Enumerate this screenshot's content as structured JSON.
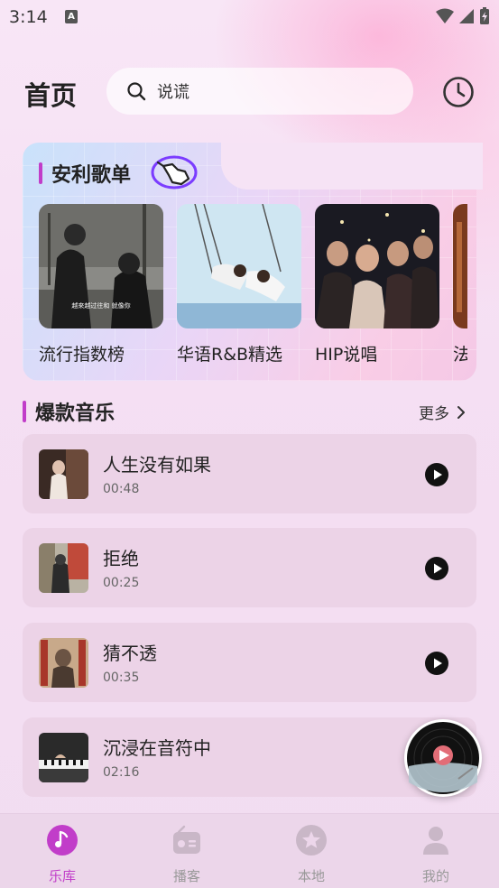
{
  "status_bar": {
    "time": "3:14"
  },
  "header": {
    "title": "首页",
    "search_placeholder": "说谎",
    "history_icon": "clock-icon"
  },
  "featured": {
    "title": "安利歌单",
    "playlists": [
      {
        "name": "流行指数榜",
        "cover_caption": "越來越过往和 就像你"
      },
      {
        "name": "华语R&B精选"
      },
      {
        "name": "HIP说唱"
      },
      {
        "name": "法"
      }
    ]
  },
  "hot": {
    "title": "爆款音乐",
    "more_label": "更多",
    "songs": [
      {
        "title": "人生没有如果",
        "duration": "00:48"
      },
      {
        "title": "拒绝",
        "duration": "00:25"
      },
      {
        "title": "猜不透",
        "duration": "00:35"
      },
      {
        "title": "沉浸在音符中",
        "duration": "02:16"
      }
    ]
  },
  "nav": {
    "items": [
      {
        "label": "乐库",
        "icon": "music-note-icon",
        "active": true
      },
      {
        "label": "播客",
        "icon": "radio-icon"
      },
      {
        "label": "本地",
        "icon": "star-icon"
      },
      {
        "label": "我的",
        "icon": "person-icon"
      }
    ]
  },
  "colors": {
    "accent": "#c13dc9",
    "card": "#ecd3e7",
    "nav_bg": "#ecd6ea"
  }
}
